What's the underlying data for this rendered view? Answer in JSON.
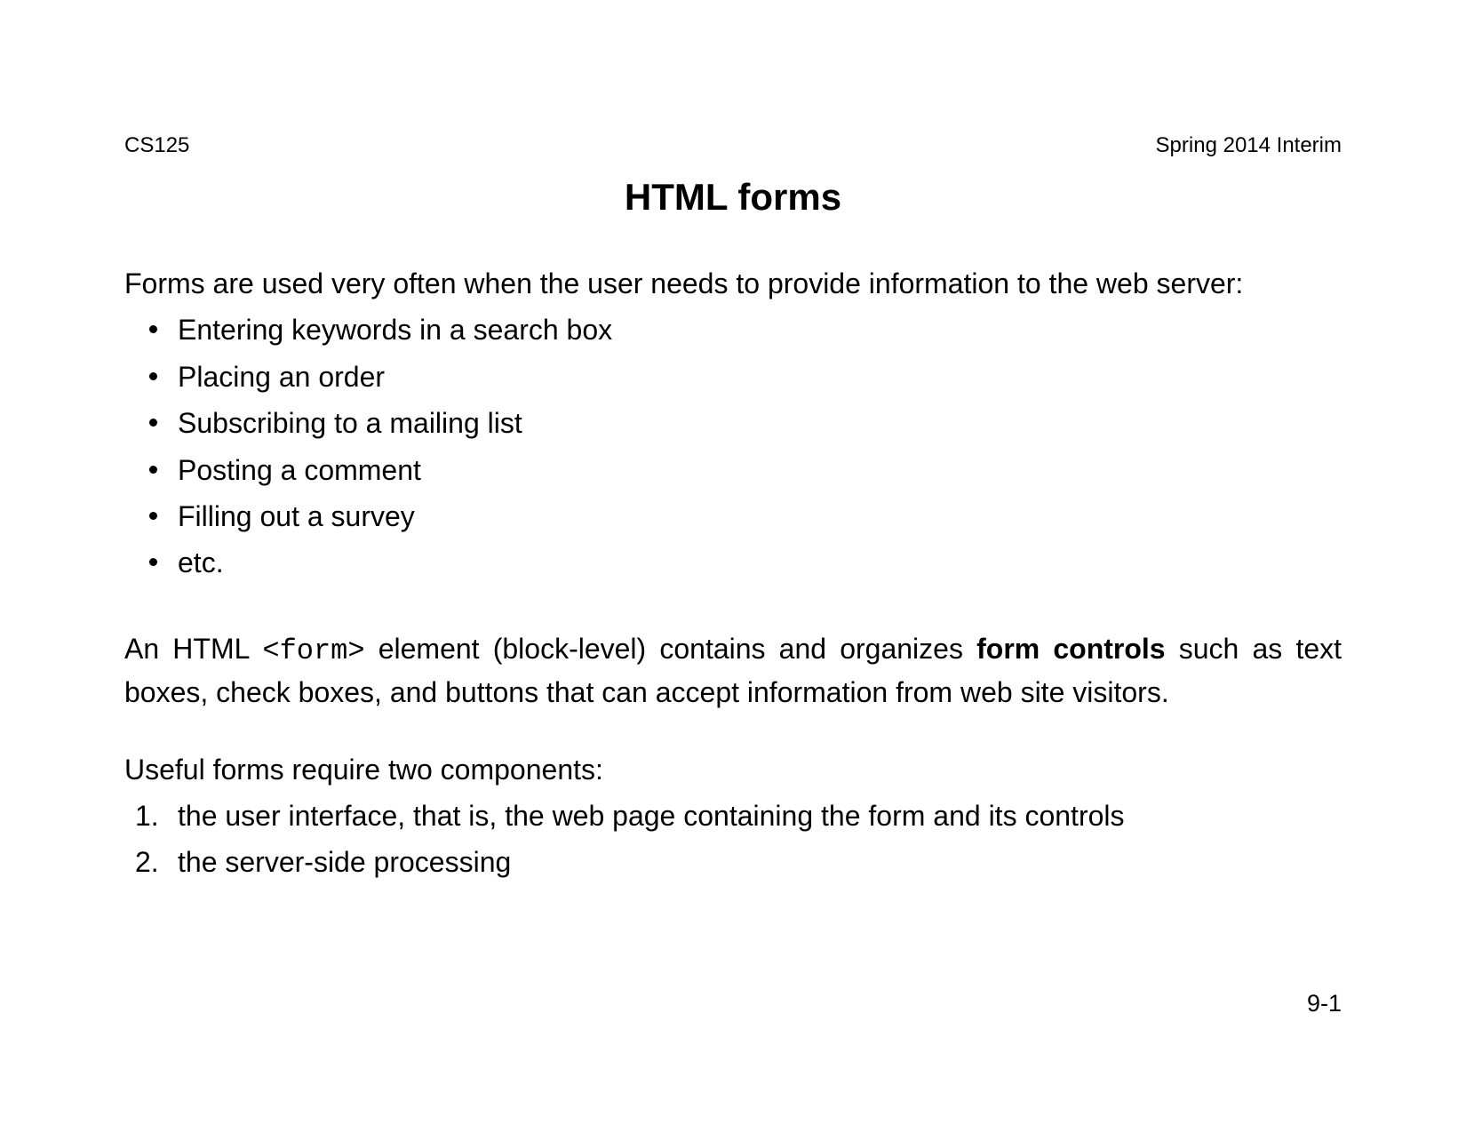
{
  "header": {
    "left": "CS125",
    "right": "Spring 2014 Interim"
  },
  "title": "HTML forms",
  "intro": "Forms are used very often when the user needs to provide information to the web server:",
  "bullets": [
    "Entering keywords in a search box",
    "Placing an order",
    "Subscribing to a mailing list",
    "Posting a comment",
    "Filling out a survey",
    "etc."
  ],
  "para2": {
    "pre": "An HTML ",
    "code": "<form>",
    "mid": " element (block-level) contains and organizes ",
    "bold": "form controls",
    "post": " such as text boxes, check boxes, and buttons that can accept information from web site visitors."
  },
  "para3": "Useful forms require two components:",
  "numbered": [
    "the user interface, that is, the web page containing the form and its controls",
    "the server-side processing"
  ],
  "pagenum": "9-1"
}
